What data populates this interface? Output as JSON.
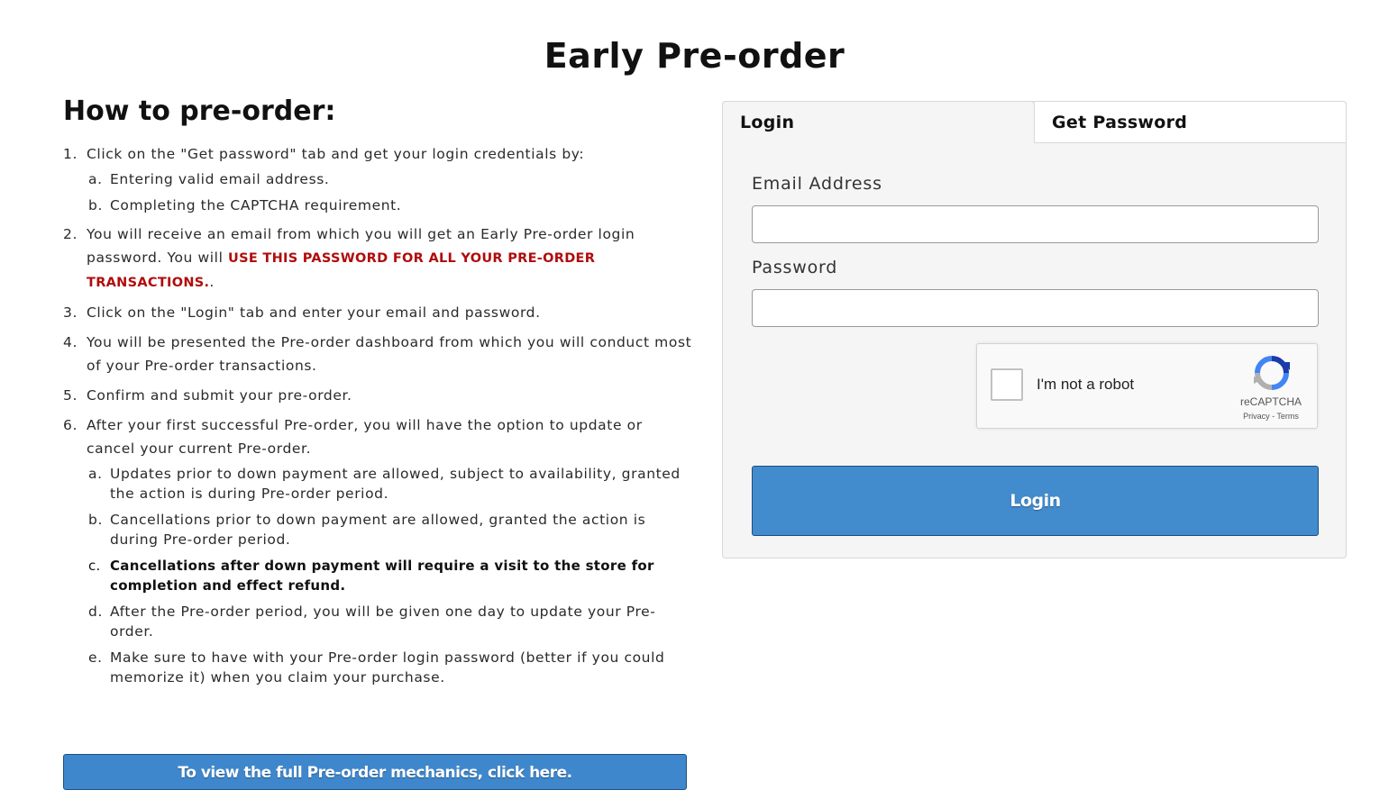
{
  "page": {
    "title": "Early Pre-order"
  },
  "instructions": {
    "heading": "How to pre-order:",
    "steps": [
      {
        "num": "1.",
        "text": "Click on the \"Get password\" tab and get your login credentials by:",
        "sub": [
          {
            "letter": "a.",
            "text": "Entering valid email address."
          },
          {
            "letter": "b.",
            "text": "Completing the CAPTCHA requirement."
          }
        ]
      },
      {
        "num": "2.",
        "text": "You will receive an email from which you will get an Early Pre-order login password. You will ",
        "emphasis": "USE THIS PASSWORD FOR ALL YOUR PRE-ORDER TRANSACTIONS.",
        "suffix": "."
      },
      {
        "num": "3.",
        "text": "Click on the \"Login\" tab and enter your email and password."
      },
      {
        "num": "4.",
        "text": "You will be presented the Pre-order dashboard from which you will conduct most of your Pre-order transactions."
      },
      {
        "num": "5.",
        "text": "Confirm and submit your pre-order."
      },
      {
        "num": "6.",
        "text": "After your first successful Pre-order, you will have the option to update or cancel your current Pre-order.",
        "sub": [
          {
            "letter": "a.",
            "text": "Updates prior to down payment are allowed, subject to availability, granted the action is during Pre-order period."
          },
          {
            "letter": "b.",
            "text": "Cancellations prior to down payment are allowed, granted the action is during Pre-order period."
          },
          {
            "letter": "c.",
            "text": "Cancellations after down payment will require a visit to the store for completion and effect refund."
          },
          {
            "letter": "d.",
            "text": "After the Pre-order period, you will be given one day to update your Pre-order."
          },
          {
            "letter": "e.",
            "text": "Make sure to have with your Pre-order login password (better if you could memorize it) when you claim your purchase."
          }
        ]
      }
    ],
    "mechanics_button": "To view the full Pre-order mechanics, click here."
  },
  "login_panel": {
    "tabs": {
      "login": "Login",
      "get_password": "Get Password"
    },
    "email_label": "Email Address",
    "email_value": "",
    "password_label": "Password",
    "password_value": "",
    "captcha": {
      "label": "I'm not a robot",
      "brand": "reCAPTCHA",
      "links": "Privacy - Terms"
    },
    "login_button": "Login"
  },
  "colors": {
    "accent_button": "#428bcd",
    "emphasis_red": "#b00c0c"
  }
}
